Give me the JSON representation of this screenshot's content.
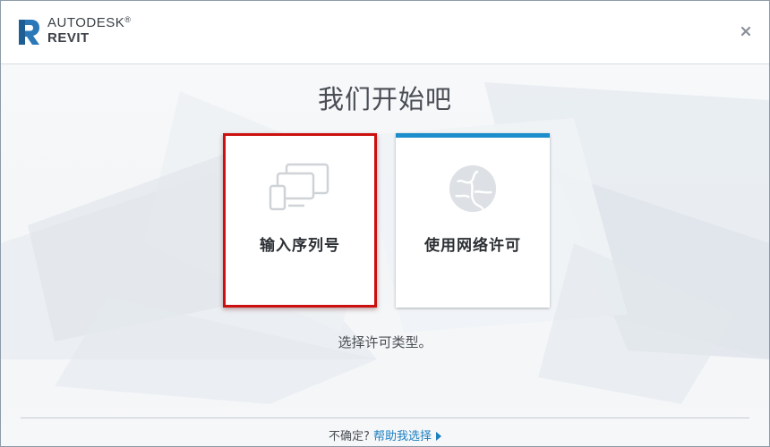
{
  "header": {
    "brand_top": "AUTODESK",
    "brand_mark": "®",
    "brand_bottom": "REVIT",
    "logo_icon": "revit-r-logo-icon",
    "close_icon": "close-icon"
  },
  "main": {
    "title": "我们开始吧",
    "cards": [
      {
        "label": "输入序列号",
        "icon": "devices-icon",
        "highlighted": true,
        "highlight_color": "#cc0f0f"
      },
      {
        "label": "使用网络许可",
        "icon": "network-globe-icon",
        "accent_color": "#1c8ecb"
      }
    ],
    "subtitle": "选择许可类型。"
  },
  "footer": {
    "question": "不确定?",
    "help_link": "帮助我选择",
    "link_color": "#1c7fc0"
  },
  "colors": {
    "accent": "#1c8ecb",
    "logo_blue": "#2b78b8"
  }
}
